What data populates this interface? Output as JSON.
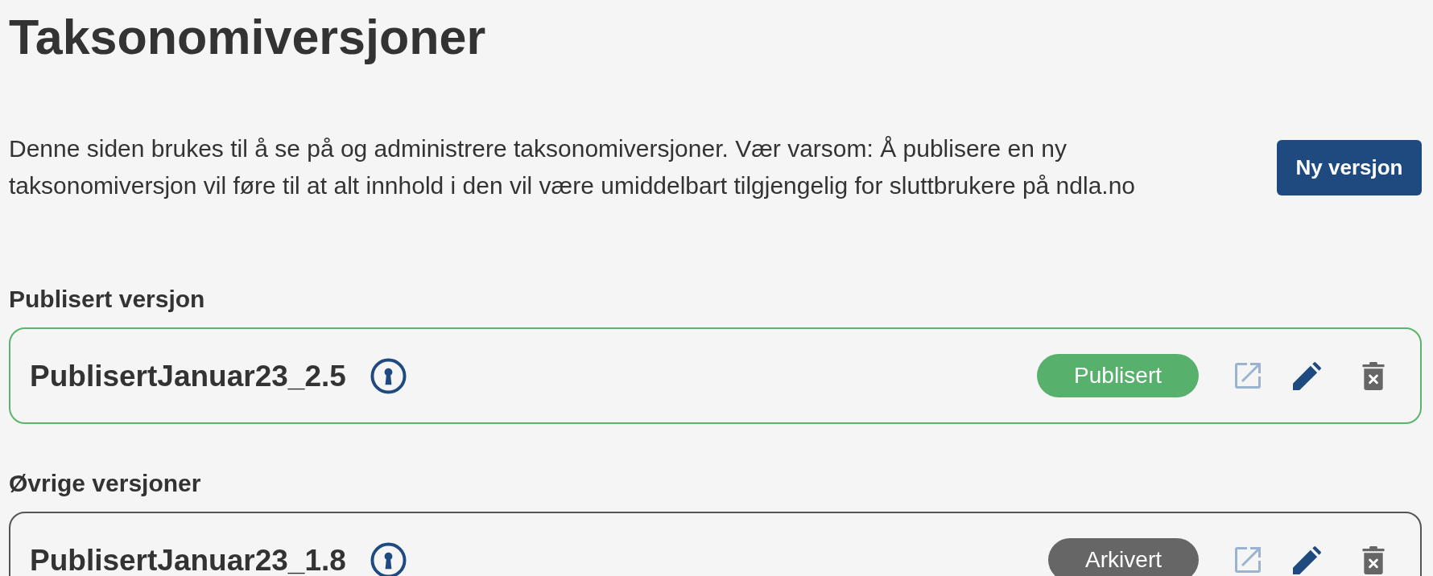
{
  "page": {
    "title": "Taksonomiversjoner",
    "description": "Denne siden brukes til å se på og administrere taksonomiversjoner. Vær varsom: Å publisere en ny taksonomiversjon vil føre til at alt innhold i den vil være umiddelbart tilgjengelig for sluttbrukere på ndla.no",
    "new_button": "Ny versjon"
  },
  "sections": [
    {
      "heading": "Publisert versjon",
      "versions": [
        {
          "name": "PublisertJanuar23_2.5",
          "locked": true,
          "kind": "published",
          "badge": "Publisert"
        }
      ]
    },
    {
      "heading": "Øvrige versjoner",
      "versions": [
        {
          "name": "PublisertJanuar23_1.8",
          "locked": true,
          "kind": "archived",
          "badge": "Arkivert"
        }
      ]
    }
  ]
}
